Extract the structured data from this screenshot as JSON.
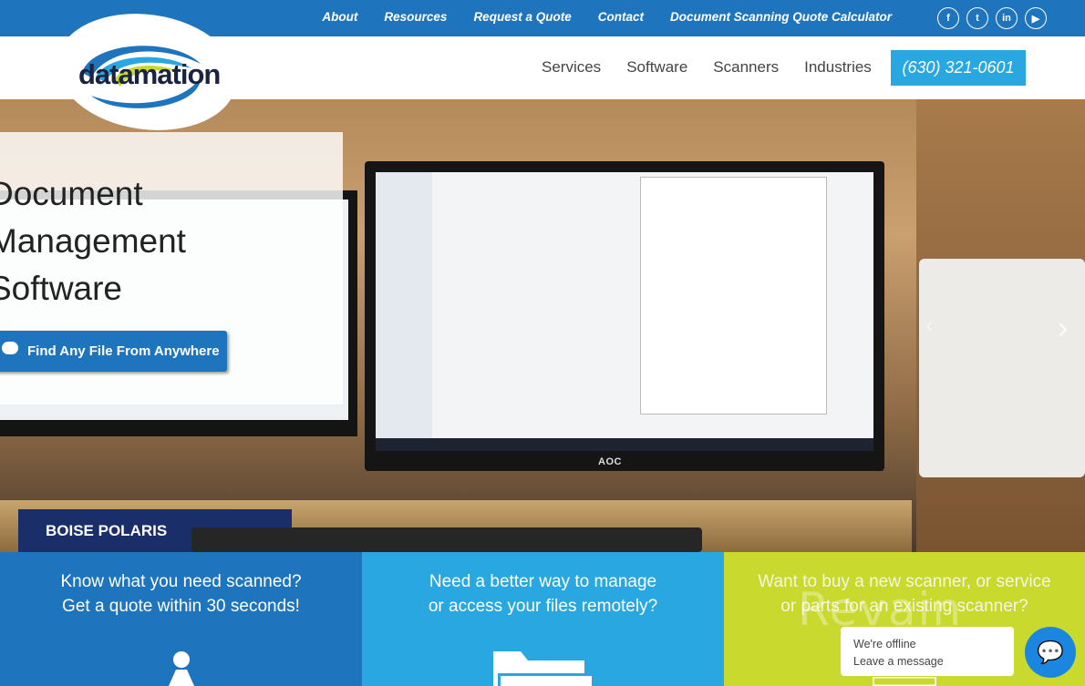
{
  "topbar": {
    "links": [
      "About",
      "Resources",
      "Request a Quote",
      "Contact",
      "Document Scanning Quote Calculator"
    ],
    "social": [
      {
        "icon": "facebook-icon",
        "glyph": "f"
      },
      {
        "icon": "twitter-icon",
        "glyph": "t"
      },
      {
        "icon": "linkedin-icon",
        "glyph": "in"
      },
      {
        "icon": "youtube-icon",
        "glyph": "▶"
      }
    ]
  },
  "logo": {
    "text": "datamation"
  },
  "nav": {
    "items": [
      "Services",
      "Software",
      "Scanners",
      "Industries"
    ],
    "phone": "(630) 321-0601"
  },
  "hero": {
    "title_lines": [
      "Document",
      "Management",
      "Software"
    ],
    "cta": "Find Any File From Anywhere",
    "box_label": "BOISE POLARIS",
    "monitor_brand": "AOC"
  },
  "panels": [
    {
      "lines": [
        "Know what you need scanned?",
        "Get a quote within 30 seconds!"
      ],
      "icon": "person-icon"
    },
    {
      "lines": [
        "Need a better way to manage",
        "or access your files remotely?"
      ],
      "icon": "folder-icon"
    },
    {
      "lines": [
        "Want to buy a new scanner, or service",
        "or parts for an existing scanner?"
      ],
      "icon": "scanner-icon"
    }
  ],
  "chat": {
    "status": "We're offline",
    "action": "Leave a message"
  },
  "watermark": "Revain",
  "colors": {
    "primary": "#1f75bd",
    "light_blue": "#29a7e1",
    "lime": "#c9d92e"
  }
}
